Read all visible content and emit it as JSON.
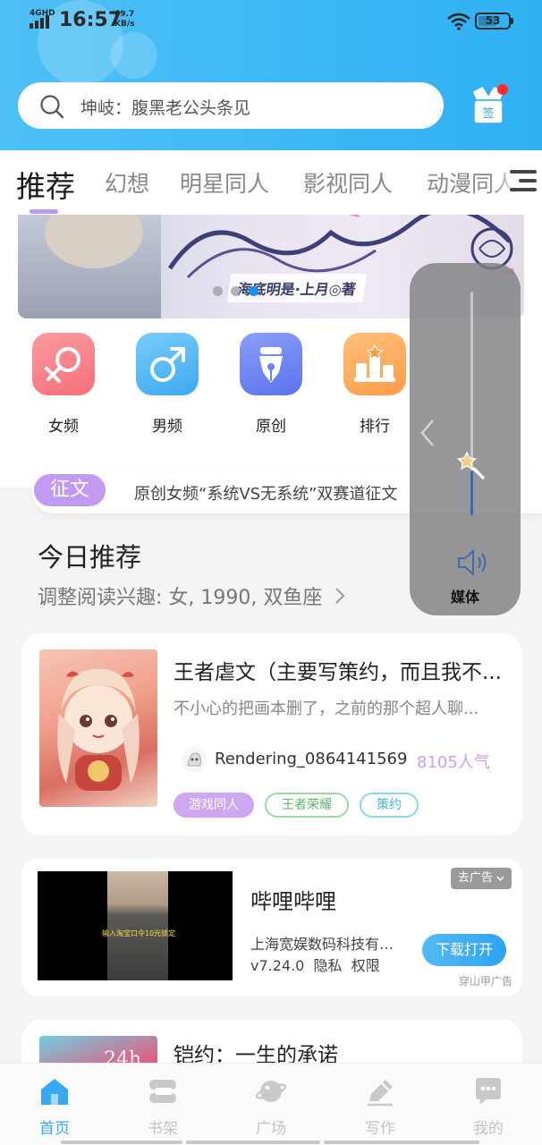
{
  "status_bar": {
    "network": "4GHD",
    "time": "16:57",
    "speed_value": "69.7",
    "speed_unit": "KB/s",
    "battery": "53"
  },
  "search": {
    "placeholder": "坤岐：腹黑老公头条见",
    "icon": "search-icon"
  },
  "signin": {
    "label": "签",
    "icon": "gift-signin-icon",
    "badge_color": "#ff2b2b"
  },
  "tabs": [
    {
      "label": "推荐",
      "active": true
    },
    {
      "label": "幻想"
    },
    {
      "label": "明星同人"
    },
    {
      "label": "影视同人"
    },
    {
      "label": "动漫同人"
    }
  ],
  "banner": {
    "subtitle": "海底明是·上月◎著",
    "slides": 3,
    "active_slide": 2
  },
  "categories": [
    {
      "label": "女频",
      "icon": "female-icon",
      "color": "#f97f86"
    },
    {
      "label": "男频",
      "icon": "male-icon",
      "color": "#52b7f4"
    },
    {
      "label": "原创",
      "icon": "pen-nib-icon",
      "color": "#6f87f2"
    },
    {
      "label": "排行",
      "icon": "ranking-podium-icon",
      "color": "#fdaa58"
    }
  ],
  "notice": {
    "badge": "征文",
    "text": "原创女频“系统VS无系统”双赛道征文"
  },
  "today": {
    "title": "今日推荐",
    "subtitle": "调整阅读兴趣: 女, 1990, 双鱼座"
  },
  "book1": {
    "title": "王者虐文（主要写策约，而且我不...",
    "description": "不小心的把画本删了，之前的那个超人聊...",
    "author": "Rendering_0864141569",
    "popularity": "8105人气",
    "tags": [
      "游戏同人",
      "王者荣耀",
      "策约"
    ]
  },
  "ad": {
    "close_label": "去广告",
    "title": "哔哩哔哩",
    "company": "上海宽娱数码科技有限公司",
    "version": "v7.24.0",
    "privacy": "隐私",
    "permissions": "权限",
    "download_label": "下载打开",
    "source": "穿山甲广告",
    "video_caption": "输入淘宝口令10元锁定"
  },
  "book2": {
    "title": "铠约：一生的承诺",
    "cover_text": "24h"
  },
  "bottom_nav": [
    {
      "label": "首页",
      "icon": "home-icon",
      "active": true
    },
    {
      "label": "书架",
      "icon": "bookshelf-icon"
    },
    {
      "label": "广场",
      "icon": "planet-icon"
    },
    {
      "label": "写作",
      "icon": "write-pen-icon"
    },
    {
      "label": "我的",
      "icon": "chat-bubble-icon"
    }
  ],
  "volume": {
    "label": "媒体",
    "level": 0.2
  },
  "colors": {
    "header": "#38b4f5",
    "accent_purple": "#c39af2",
    "active_blue": "#3aa7f2"
  }
}
